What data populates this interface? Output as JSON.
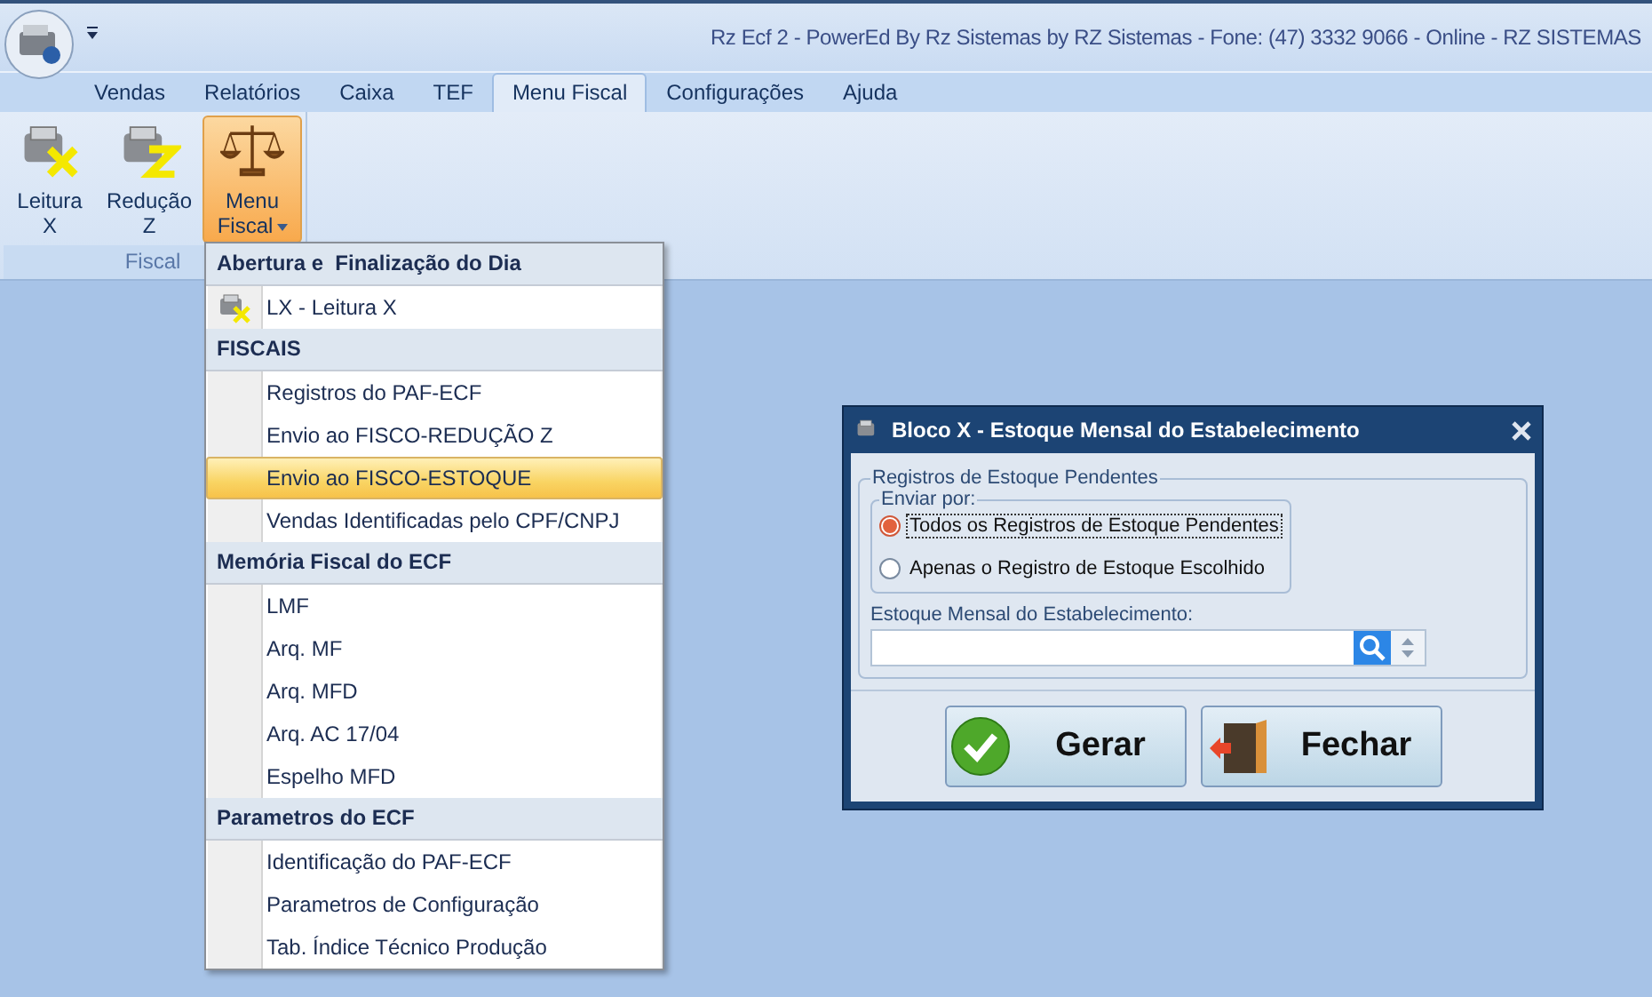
{
  "window": {
    "title": "Rz Ecf 2 - PowerEd By Rz Sistemas by RZ Sistemas - Fone: (47) 3332 9066 - Online - RZ SISTEMAS"
  },
  "tabs": [
    {
      "label": "Vendas",
      "selected": false
    },
    {
      "label": "Relatórios",
      "selected": false
    },
    {
      "label": "Caixa",
      "selected": false
    },
    {
      "label": "TEF",
      "selected": false
    },
    {
      "label": "Menu Fiscal",
      "selected": true
    },
    {
      "label": "Configurações",
      "selected": false
    },
    {
      "label": "Ajuda",
      "selected": false
    }
  ],
  "ribbon": {
    "groups": [
      {
        "label": "Fiscal",
        "buttons": [
          {
            "kind": "print-x",
            "lines": [
              "Leitura",
              "X"
            ],
            "pressed": false,
            "dropdown": false
          },
          {
            "kind": "print-z",
            "lines": [
              "Redução",
              "Z"
            ],
            "pressed": false,
            "dropdown": false
          },
          {
            "kind": "scales",
            "lines": [
              "Menu",
              "Fiscal"
            ],
            "pressed": true,
            "dropdown": true
          }
        ]
      }
    ]
  },
  "menu": {
    "sections": [
      {
        "header": "Abertura e  Finalização do Dia",
        "items": [
          {
            "label": "LX - Leitura X",
            "kind": "icon",
            "selected": false
          }
        ]
      },
      {
        "header": "FISCAIS",
        "items": [
          {
            "label": "Registros do PAF-ECF",
            "kind": "plain",
            "selected": false
          },
          {
            "label": "Envio ao FISCO-REDUÇÃO Z",
            "kind": "plain",
            "selected": false
          },
          {
            "label": "Envio ao FISCO-ESTOQUE",
            "kind": "plain",
            "selected": true
          },
          {
            "label": "Vendas Identificadas pelo CPF/CNPJ",
            "kind": "plain",
            "selected": false
          }
        ]
      },
      {
        "header": "Memória Fiscal do ECF",
        "items": [
          {
            "label": "LMF",
            "kind": "plain",
            "selected": false
          },
          {
            "label": "Arq. MF",
            "kind": "plain",
            "selected": false
          },
          {
            "label": "Arq. MFD",
            "kind": "plain",
            "selected": false
          },
          {
            "label": "Arq. AC 17/04",
            "kind": "plain",
            "selected": false
          },
          {
            "label": "Espelho MFD",
            "kind": "plain",
            "selected": false
          }
        ]
      },
      {
        "header": "Parametros do ECF",
        "items": [
          {
            "label": "Identificação do PAF-ECF",
            "kind": "plain",
            "selected": false
          },
          {
            "label": "Parametros de Configuração",
            "kind": "plain",
            "selected": false
          },
          {
            "label": "Tab. Índice Técnico Produção",
            "kind": "plain",
            "selected": false
          }
        ]
      }
    ]
  },
  "dialog": {
    "title": "Bloco X - Estoque Mensal do Estabelecimento",
    "group": "Registros de Estoque Pendentes",
    "subgroup": "Enviar por:",
    "options": [
      {
        "label": "Todos os Registros de Estoque Pendentes",
        "selected": true
      },
      {
        "label": "Apenas o Registro de Estoque Escolhido",
        "selected": false
      }
    ],
    "field_label": "Estoque Mensal do Estabelecimento:",
    "buttons": [
      {
        "label": "Gerar",
        "kind": "confirm"
      },
      {
        "label": "Fechar",
        "kind": "close"
      }
    ]
  }
}
